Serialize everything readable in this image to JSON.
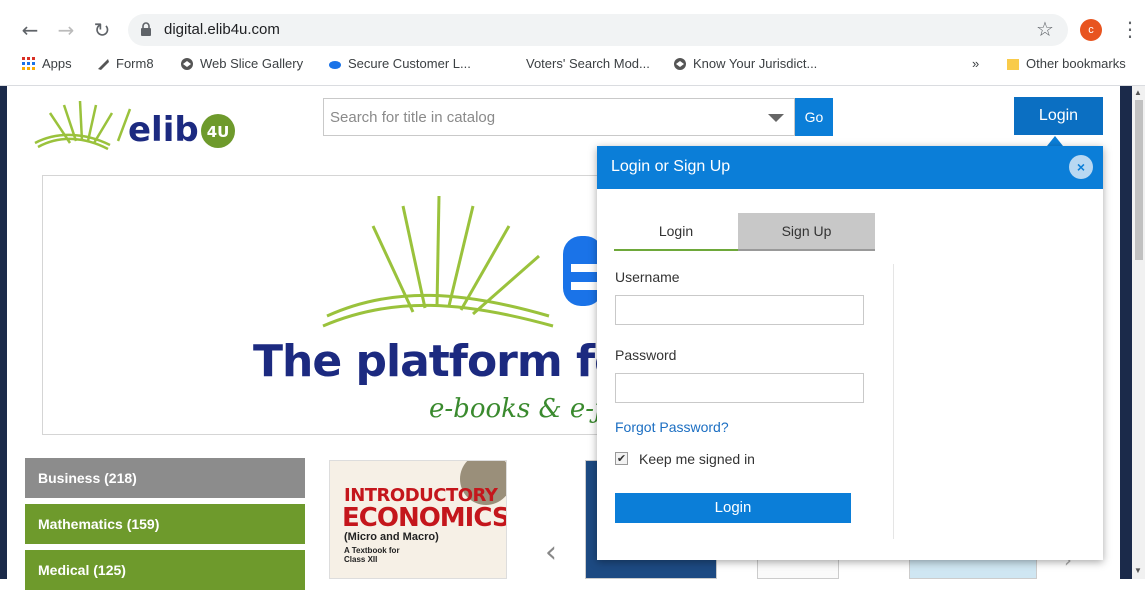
{
  "browser": {
    "url": "digital.elib4u.com",
    "avatar_letter": "c",
    "bookmarks": [
      {
        "label": "Apps",
        "icon": "apps-grid-icon"
      },
      {
        "label": "Form8",
        "icon": "form-icon"
      },
      {
        "label": "Web Slice Gallery",
        "icon": "globe-icon"
      },
      {
        "label": "Secure Customer L...",
        "icon": "cloud-icon"
      },
      {
        "label": "Voters' Search Mod...",
        "icon": "page-icon"
      },
      {
        "label": "Know Your Jurisdict...",
        "icon": "globe-icon"
      }
    ],
    "more_bookmarks": "»",
    "other_bookmarks": "Other bookmarks"
  },
  "header": {
    "logo_text": "elib",
    "logo_badge": "4U",
    "search_placeholder": "Search for title in catalog",
    "go_label": "Go",
    "login_label": "Login"
  },
  "banner": {
    "tagline": "The platform for e",
    "subtagline": "e-books & e-j"
  },
  "categories": [
    {
      "label": "Business  (218)",
      "color": "#8c8c8c"
    },
    {
      "label": "Mathematics  (159)",
      "color": "#6e9a2c"
    },
    {
      "label": "Medical  (125)",
      "color": "#6e9a2c"
    }
  ],
  "book": {
    "title1": "INTRODUCTORY",
    "title2": "ECONOMICS",
    "subtitle": "(Micro and Macro)",
    "note": "A Textbook for Class XII"
  },
  "modal": {
    "title": "Login or Sign Up",
    "close": "×",
    "tab_login": "Login",
    "tab_signup": "Sign Up",
    "username_label": "Username",
    "password_label": "Password",
    "forgot": "Forgot Password?",
    "keep_signed": "Keep me signed in",
    "keep_checked": true,
    "submit": "Login"
  },
  "colors": {
    "primary_blue": "#0b7ed8",
    "green": "#6e9a2c",
    "navy": "#1c2a80"
  }
}
